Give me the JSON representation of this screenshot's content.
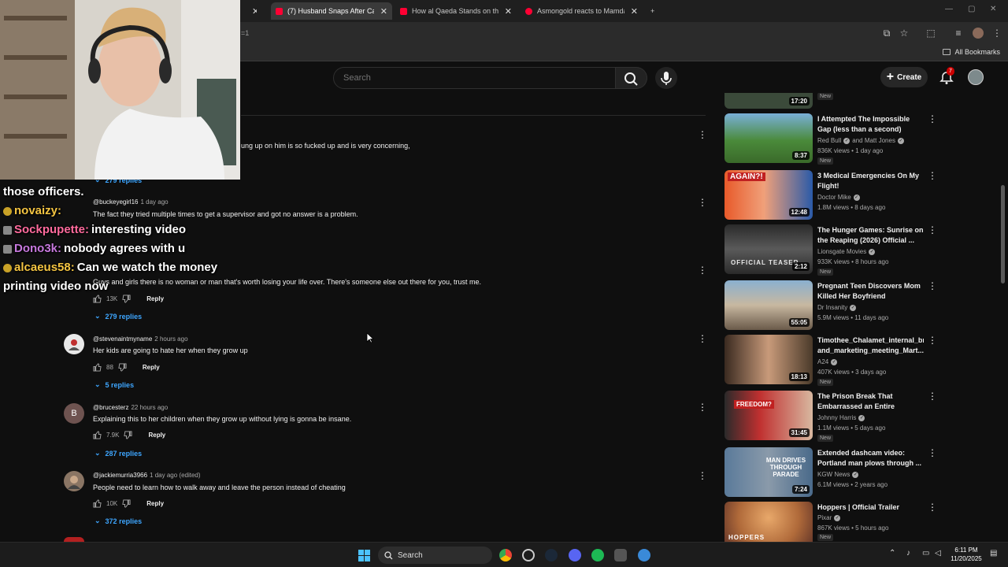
{
  "browser": {
    "tabs": [
      {
        "title": "(7) Husband Snaps After Catch",
        "active": true
      },
      {
        "title": "How al Qaeda Stands on the Br",
        "active": false
      },
      {
        "title": "Asmongold reacts to Mamdani",
        "active": false
      }
    ],
    "address_suffix": "=1",
    "all_bookmarks": "All Bookmarks"
  },
  "youtube": {
    "search_placeholder": "Search",
    "create_label": "Create",
    "notification_count": "7"
  },
  "comments": {
    "top_fragment": "ung up on him is so fucked up and is very concerning,",
    "partial_replies_label": "279 replies",
    "items": [
      {
        "author": "@buckeyegirl16",
        "time": "1 day ago",
        "text": "The fact they tried multiple times to get a supervisor and got no answer is a problem.",
        "likes": "",
        "replies": ""
      },
      {
        "author": "",
        "time": "",
        "text": "Guys and girls there is no woman or man that's worth losing your life over. There's someone else out there for you, trust me.",
        "likes": "13K",
        "reply_label": "Reply",
        "replies": "279 replies"
      },
      {
        "author": "@stevenaintmyname",
        "time": "2 hours ago",
        "text": "Her kids are going to hate her when they grow up",
        "likes": "88",
        "reply_label": "Reply",
        "replies": "5 replies"
      },
      {
        "author": "@brucesterz",
        "time": "22 hours ago",
        "avatar_letter": "B",
        "text": "Explaining this to her children when they grow up without lying is gonna be insane.",
        "likes": "7.9K",
        "reply_label": "Reply",
        "replies": "287 replies"
      },
      {
        "author": "@jackiemurria3966",
        "time": "1 day ago (edited)",
        "text": "People need to learn how to walk away and leave the person instead of cheating",
        "likes": "10K",
        "reply_label": "Reply",
        "replies": "372 replies"
      }
    ]
  },
  "sidebar": {
    "first_duration": "17:20",
    "first_new": "New",
    "videos": [
      {
        "title": "I Attempted The Impossible Gap (less than a second)",
        "channel": "Red Bull",
        "channel2": "and Matt Jones",
        "meta": "836K views • 1 day ago",
        "duration": "8:37",
        "new": "New",
        "thumb_color": "#4a8a3a"
      },
      {
        "title": "3 Medical Emergencies On My Flight!",
        "channel": "Doctor Mike",
        "meta": "1.8M views • 8 days ago",
        "duration": "12:48",
        "new": "",
        "thumb_color": "#d94a2a",
        "thumb_text": "AGAIN?!"
      },
      {
        "title": "The Hunger Games: Sunrise on the Reaping (2026) Official ...",
        "channel": "Lionsgate Movies",
        "meta": "933K views • 8 hours ago",
        "duration": "2:12",
        "new": "New",
        "thumb_color": "#3a3a3a",
        "thumb_text": "OFFICIAL TEASER"
      },
      {
        "title": "Pregnant Teen Discovers Mom Killed Her Boyfriend",
        "channel": "Dr Insanity",
        "meta": "5.9M views • 11 days ago",
        "duration": "55:05",
        "new": "",
        "thumb_color": "#8a7a5a"
      },
      {
        "title": "Timothee_Chalamet_internal_br and_marketing_meeting_Mart...",
        "channel": "A24",
        "meta": "407K views • 3 days ago",
        "duration": "18:13",
        "new": "New",
        "thumb_color": "#6a5a4a"
      },
      {
        "title": "The Prison Break That Embarrassed an Entire Country",
        "channel": "Johnny Harris",
        "meta": "1.1M views • 5 days ago",
        "duration": "31:45",
        "new": "New",
        "thumb_color": "#b03030",
        "thumb_text": "FREEDOM?"
      },
      {
        "title": "Extended dashcam video: Portland man plows through ...",
        "channel": "KGW News",
        "meta": "6.1M views • 2 years ago",
        "duration": "7:24",
        "new": "",
        "thumb_color": "#4a6a8a",
        "thumb_text": "MAN DRIVES THROUGH PARADE"
      },
      {
        "title": "Hoppers | Official Trailer",
        "channel": "Pixar",
        "meta": "867K views • 5 hours ago",
        "duration": "",
        "new": "New",
        "thumb_color": "#c07a3a",
        "thumb_text": "HOPPERS"
      }
    ]
  },
  "stream_chat": {
    "lines": [
      {
        "user": "",
        "message": "those officers."
      },
      {
        "user": "novaizy:",
        "message": "",
        "user_color": "#f5c542"
      },
      {
        "user": "Sockpupette:",
        "message": "interesting video",
        "user_color": "#ff6b9d"
      },
      {
        "user": "Dono3k:",
        "message": "nobody agrees with u",
        "user_color": "#c678dd"
      },
      {
        "user": "alcaeus58:",
        "message": "Can we watch the money",
        "user_color": "#f5c542"
      },
      {
        "user": "",
        "message": "printing video now"
      }
    ]
  },
  "taskbar": {
    "search_label": "Search",
    "time": "6:11 PM",
    "date": "11/20/2025"
  }
}
